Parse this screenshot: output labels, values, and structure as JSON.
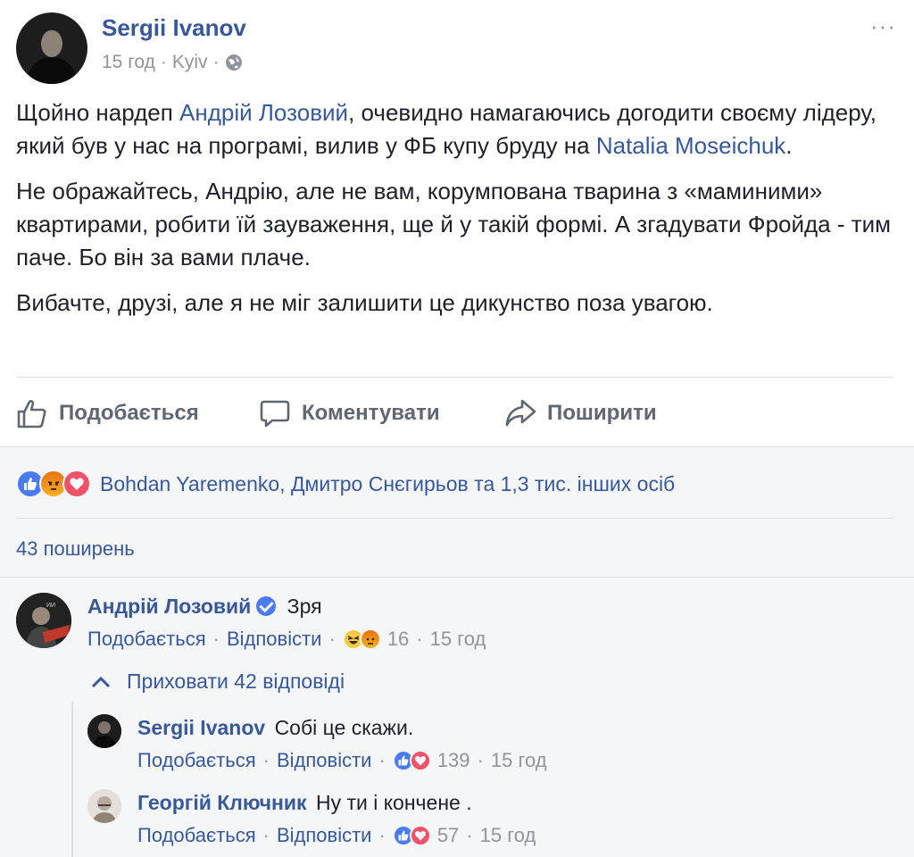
{
  "post": {
    "author": "Sergii Ivanov",
    "time": "15 год",
    "location": "Kyiv",
    "more": "···",
    "paragraph1": {
      "t1": "Щойно нардеп ",
      "mention1": "Андрій Лозовий",
      "t2": ", очевидно намагаючись догодити своєму лідеру, який був у нас на програмі, вилив у ФБ купу бруду на ",
      "mention2": "Natalia Moseichuk",
      "t3": "."
    },
    "paragraph2": "Не ображайтесь, Андрію, але не вам, корумпована тварина з «маминими» квартирами, робити їй зауваження, ще й у такій формі. А згадувати Фройда - тим паче. Бо він за вами плаче.",
    "paragraph3": "Вибачте, друзі, але я не міг залишити це дикунство поза увагою."
  },
  "actions": {
    "like": "Подобається",
    "comment": "Коментувати",
    "share": "Поширити"
  },
  "reactions": {
    "summary": "Bohdan Yaremenko, Дмитро Снєгирьов та 1,3 тис. інших осіб",
    "icons": [
      "like",
      "angry",
      "love"
    ]
  },
  "shares": "43 поширень",
  "comments": [
    {
      "name": "Андрій Лозовий",
      "verified": true,
      "text": "Зря",
      "like_label": "Подобається",
      "reply_label": "Відповісти",
      "reaction_icons": [
        "haha",
        "angry"
      ],
      "reaction_count": "16",
      "time": "15 год"
    }
  ],
  "hide_replies": "Приховати 42 відповіді",
  "replies": [
    {
      "name": "Sergii Ivanov",
      "text": "Собі це скажи.",
      "like_label": "Подобається",
      "reply_label": "Відповісти",
      "reaction_icons": [
        "like",
        "love"
      ],
      "reaction_count": "139",
      "time": "15 год"
    },
    {
      "name": "Георгій Ключник",
      "text": "Ну ти і кончене .",
      "like_label": "Подобається",
      "reply_label": "Відповісти",
      "reaction_icons": [
        "like",
        "love"
      ],
      "reaction_count": "57",
      "time": "15 год"
    }
  ],
  "colors": {
    "link": "#385898",
    "meta": "#90949c",
    "text": "#1d2129",
    "like_blue": "#4a7bf5",
    "love_red": "#f25268"
  }
}
